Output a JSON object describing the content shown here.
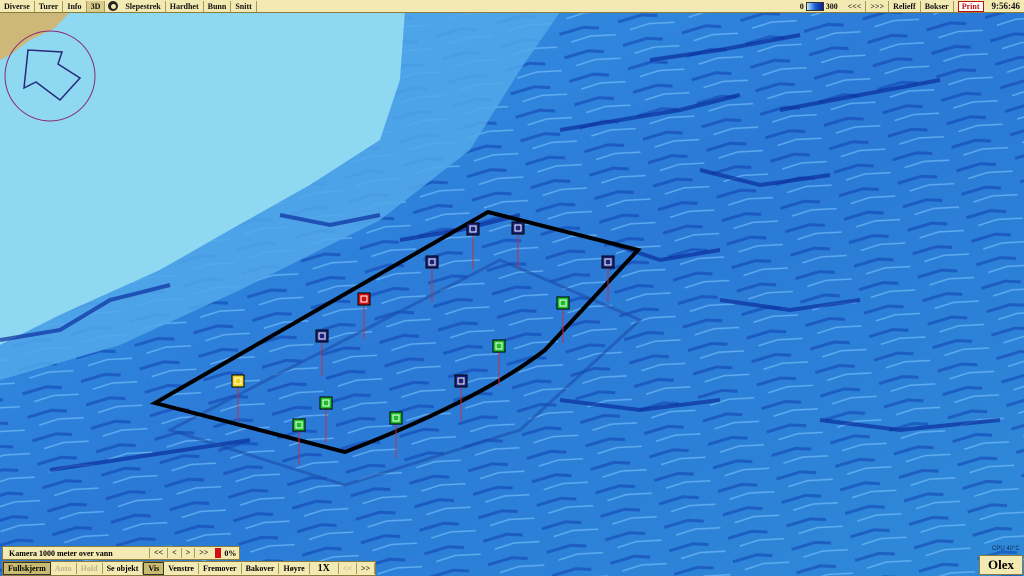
{
  "menu": {
    "items": [
      {
        "label": "Diverse",
        "active": false
      },
      {
        "label": "Turer",
        "active": false
      },
      {
        "label": "Info",
        "active": false
      },
      {
        "label": "3D",
        "active": true
      }
    ],
    "items2": [
      {
        "label": "Slepestrek"
      },
      {
        "label": "Hardhet"
      },
      {
        "label": "Bunn"
      },
      {
        "label": "Snitt"
      }
    ],
    "scale_min": "0",
    "scale_max": "300",
    "nav_back": "<<<",
    "nav_fwd": ">>>",
    "relieff": "Relieff",
    "bokser": "Bokser",
    "print": "Print",
    "clock": "9:56:46"
  },
  "camera": {
    "label": "Kamera 1000 meter over vann",
    "buttons": [
      "<<",
      "<",
      ">",
      ">>"
    ],
    "percent": "0%"
  },
  "bottom": {
    "buttons": [
      {
        "label": "Fullskjerm",
        "state": "active",
        "name": "fullskjerm-button"
      },
      {
        "label": "Auto",
        "state": "disabled",
        "name": "auto-button"
      },
      {
        "label": "Hold",
        "state": "disabled",
        "name": "hold-button"
      },
      {
        "label": "Se objekt",
        "state": "normal",
        "name": "se-objekt-button"
      },
      {
        "label": "Vis",
        "state": "active",
        "name": "vis-button"
      },
      {
        "label": "Venstre",
        "state": "normal",
        "name": "venstre-button"
      },
      {
        "label": "Fremover",
        "state": "normal",
        "name": "fremover-button"
      },
      {
        "label": "Bakover",
        "state": "normal",
        "name": "bakover-button"
      },
      {
        "label": "Høyre",
        "state": "normal",
        "name": "hoyre-button"
      }
    ],
    "speed": "1X",
    "speed_down": "<<",
    "speed_up": ">>"
  },
  "cpu_label": "CPU 40°C",
  "brand": "Olex",
  "markers": [
    {
      "color": "blue"
    },
    {
      "color": "blue"
    },
    {
      "color": "blue"
    },
    {
      "color": "red"
    },
    {
      "color": "blue"
    },
    {
      "color": "blue"
    },
    {
      "color": "green"
    },
    {
      "color": "green"
    },
    {
      "color": "yellow"
    },
    {
      "color": "blue"
    },
    {
      "color": "green"
    },
    {
      "color": "green"
    },
    {
      "color": "green"
    }
  ],
  "colors": {
    "menu_bg": "#f3e9b2",
    "shallow": "#8fd8f2",
    "deep": "#1d5fd2",
    "marker_blue": "#1a237e",
    "marker_green": "#1bbf2a",
    "marker_red": "#d01010",
    "marker_yellow": "#f1d21a"
  }
}
